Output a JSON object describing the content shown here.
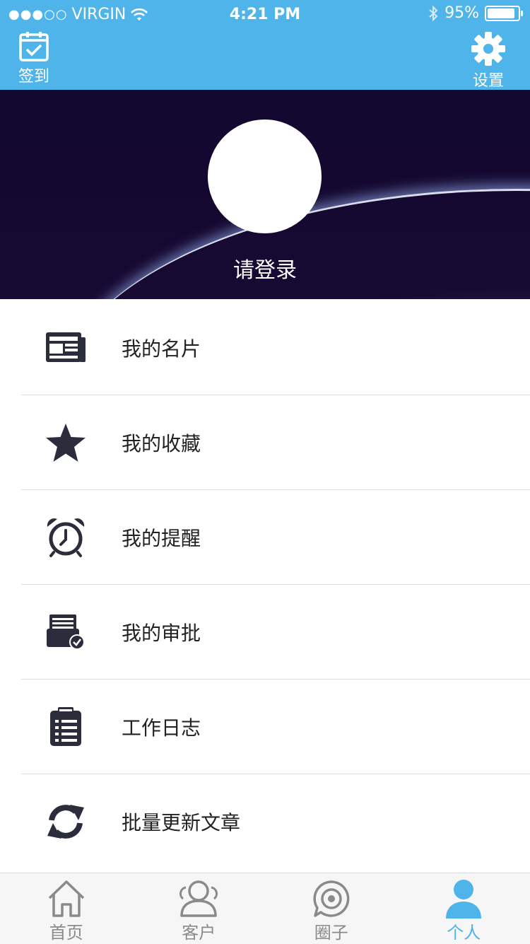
{
  "status_bar": {
    "carrier": "VIRGIN",
    "time": "4:21 PM",
    "battery": "95%",
    "signal_dots": "●●●○○"
  },
  "nav": {
    "checkin_label": "签到",
    "settings_label": "设置"
  },
  "profile": {
    "login_prompt": "请登录"
  },
  "menu": {
    "items": [
      {
        "label": "我的名片",
        "icon": "business-card-icon"
      },
      {
        "label": "我的收藏",
        "icon": "star-icon"
      },
      {
        "label": "我的提醒",
        "icon": "alarm-clock-icon"
      },
      {
        "label": "我的审批",
        "icon": "approval-icon"
      },
      {
        "label": "工作日志",
        "icon": "clipboard-icon"
      },
      {
        "label": "批量更新文章",
        "icon": "refresh-icon"
      }
    ]
  },
  "tabs": [
    {
      "label": "首页",
      "icon": "home-icon"
    },
    {
      "label": "客户",
      "icon": "customers-icon"
    },
    {
      "label": "圈子",
      "icon": "circle-icon"
    },
    {
      "label": "个人",
      "icon": "person-icon",
      "active": true
    }
  ],
  "colors": {
    "accent": "#4fb4ea",
    "icon_dark": "#2b2d3c",
    "tab_inactive": "#8a8a8a"
  }
}
